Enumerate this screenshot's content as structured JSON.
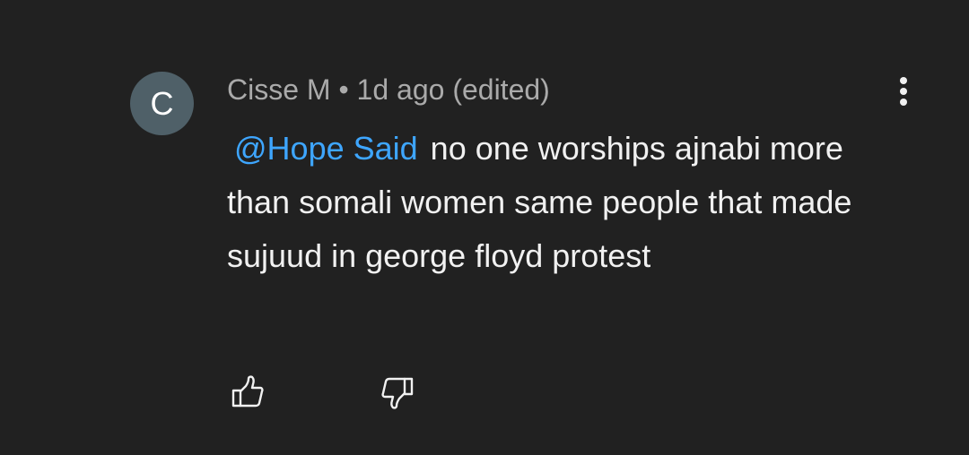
{
  "comment": {
    "avatar_letter": "C",
    "author": "Cisse M",
    "separator": "•",
    "time": "1d ago",
    "edited": "(edited)",
    "mention": "@Hope Said",
    "text": "no one worships ajnabi more than somali women same people that made sujuud in george floyd protest"
  },
  "icons": {
    "menu": "more-vert-icon",
    "like": "thumb-up-icon",
    "dislike": "thumb-down-icon"
  },
  "colors": {
    "background": "#212121",
    "mention": "#3ea6ff",
    "meta_text": "#aaaaaa",
    "body_text": "#f1f1f1",
    "avatar": "#4f6068"
  }
}
